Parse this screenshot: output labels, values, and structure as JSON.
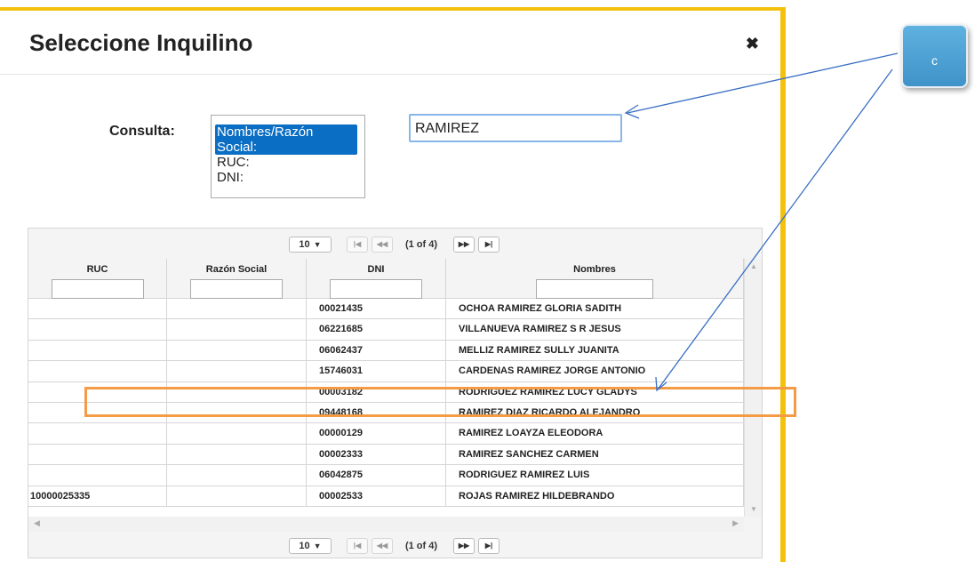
{
  "dialog": {
    "title": "Seleccione Inquilino",
    "close_symbol": "✖"
  },
  "query": {
    "label": "Consulta:",
    "options": [
      "Nombres/Razón Social:",
      "RUC:",
      "DNI:"
    ],
    "selected_index": 0,
    "search_value": "RAMIREZ"
  },
  "paginator": {
    "rows_per_page": "10",
    "chevron": "▼",
    "first_symbol": "|◀",
    "prev_symbol": "◀◀",
    "page_info": "(1 of 4)",
    "next_symbol": "▶▶",
    "last_symbol": "▶|"
  },
  "table": {
    "columns": [
      "RUC",
      "Razón Social",
      "DNI",
      "Nombres"
    ],
    "rows": [
      {
        "ruc": "",
        "razon": "",
        "dni": "00021435",
        "nombres": "OCHOA RAMIREZ GLORIA SADITH"
      },
      {
        "ruc": "",
        "razon": "",
        "dni": "06221685",
        "nombres": "VILLANUEVA RAMIREZ S R JESUS"
      },
      {
        "ruc": "",
        "razon": "",
        "dni": "06062437",
        "nombres": "MELLIZ RAMIREZ SULLY JUANITA"
      },
      {
        "ruc": "",
        "razon": "",
        "dni": "15746031",
        "nombres": "CARDENAS RAMIREZ JORGE ANTONIO"
      },
      {
        "ruc": "",
        "razon": "",
        "dni": "00003182",
        "nombres": "RODRIGUEZ RAMIREZ LUCY GLADYS"
      },
      {
        "ruc": "",
        "razon": "",
        "dni": "09448168",
        "nombres": "RAMIREZ DIAZ RICARDO ALEJANDRO"
      },
      {
        "ruc": "",
        "razon": "",
        "dni": "00000129",
        "nombres": "RAMIREZ LOAYZA ELEODORA"
      },
      {
        "ruc": "",
        "razon": "",
        "dni": "00002333",
        "nombres": "RAMIREZ SANCHEZ CARMEN"
      },
      {
        "ruc": "",
        "razon": "",
        "dni": "06042875",
        "nombres": "RODRIGUEZ RAMIREZ LUIS"
      },
      {
        "ruc": "10000025335",
        "razon": "",
        "dni": "00002533",
        "nombres": "ROJAS RAMIREZ HILDEBRANDO"
      }
    ]
  },
  "annotation": {
    "callout_label": "c",
    "callout_color": "#4aa3d8",
    "highlight_color": "#f59a45",
    "arrow_color": "#3a6fc4"
  }
}
